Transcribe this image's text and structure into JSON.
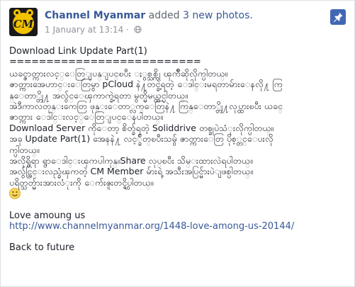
{
  "post": {
    "page_name": "Channel Myanmar",
    "action_prefix": "added",
    "action_count": "3 new photos.",
    "timestamp": "1 January at 13:14",
    "separator": "·",
    "privacy_icon": "globe-icon",
    "pin_icon": "pin-icon",
    "avatar_logo_text": "CM"
  },
  "content": {
    "title": "Download Link Update Part(1)",
    "rule": "==========================",
    "lines": [
      "ယခင္ဇာတ္ကားလင့္ေတြျပန္ျပင္ၿပီး ႏွစ္သစ္ကို ၾကိဳဆိုလိုက္ပါတယ္။",
      "ဇာတ္ကားအေဟာင္းေတြမွာ pCloud နဲ႔တင္ခဲ့ရတဲ့ ေဒါင္းမရတာမ်ားေနလို႔ ကြ",
      "န္ေတာ္တို႔ အလွ်င္ေၾကာက္ခဲ့ရတာ မွတ္မိမယ္ထင္ပါတယ္။",
      "အဲဒီကာလတုန္းကေတြ ဖုန္းေတာ္လက္ေတြနဲ႔ ကြန္ေတာ္တို႔လုပ္ထားၿပီး ယခင္",
      "ဇာတ္ကား ေဒါင္းလင့္ေတြျပင္ေနပါတယ္။",
      "Download Server ကိုေတာ့ စိတ္ခ်ရတဲ့ Soliddrive တစ္ခုပဲသံုးလိုက္ပါတယ္။",
      "အခု Update Part(1) အေနနဲ႔ လင့္ခ်ိတ္ၿပီးသမွ် ဇာတ္ကားေတြ ပိုစ့္တင္ေပးလို",
      "က္ပါတယ္။",
      "အလိုရွိရာ ရွာေဒါင္းၾကပါကုန္။Share လုပ္ၿပီး သိမ္းထားလဲရပါတယ္။",
      "အလွ်င္သြင္းလည္ခံၾကတဲ့ CM Member မ်ားရဲ့ အသီးအပြင္မ်ားပဲျဖစ္ပါတယ္။",
      "ပရိတ္သတ္မ်ားအားလံုးကို ေက်းဇူးတင္ရွိပါတယ္။"
    ],
    "emoji": "smiley-icon",
    "section_title": "Love amoung us",
    "link": "http://www.channelmyanmar.org/1448-love-among-us-20144/",
    "footer_line": "Back to future"
  },
  "colors": {
    "link": "#385898",
    "meta": "#90949c",
    "pin_bg": "#4267b2",
    "avatar_bg": "#1a1a1a",
    "avatar_yellow": "#f2c200"
  }
}
